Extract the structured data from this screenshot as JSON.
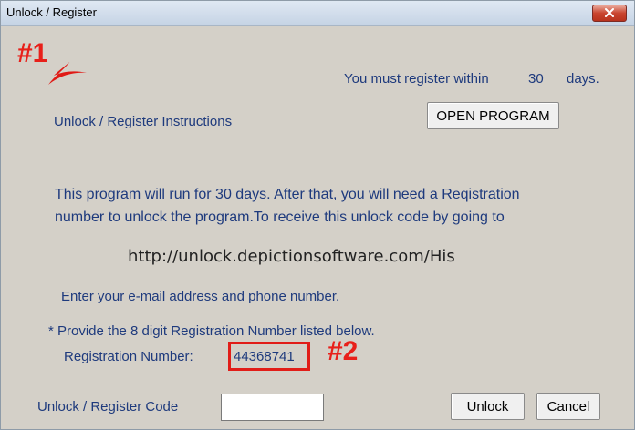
{
  "window": {
    "title": "Unlock / Register",
    "close_icon": "close-icon"
  },
  "annotations": {
    "marker1": "#1",
    "marker2": "#2"
  },
  "header": {
    "must_register_prefix": "You must register within",
    "days_count": "30",
    "days_suffix": "days.",
    "open_program_label": "OPEN PROGRAM"
  },
  "instructions": {
    "heading": "Unlock / Register Instructions",
    "line1": "This program will run for 30 days. After that, you will need a  Reqistration",
    "line2": "number to unlock the program.To receive this unlock code by going to",
    "url": "http://unlock.depictionsoftware.com/His",
    "email_line": "Enter your e-mail address  and phone number.",
    "provide_line": "*  Provide the 8 digit Registration Number listed below."
  },
  "registration": {
    "label": "Registration Number:",
    "number": "44368741"
  },
  "footer": {
    "code_label": "Unlock / Register Code",
    "code_value": "",
    "unlock_label": "Unlock",
    "cancel_label": "Cancel"
  },
  "colors": {
    "text_blue": "#1e3a7d",
    "annotation_red": "#e8201a",
    "background": "#d4d0c8"
  }
}
